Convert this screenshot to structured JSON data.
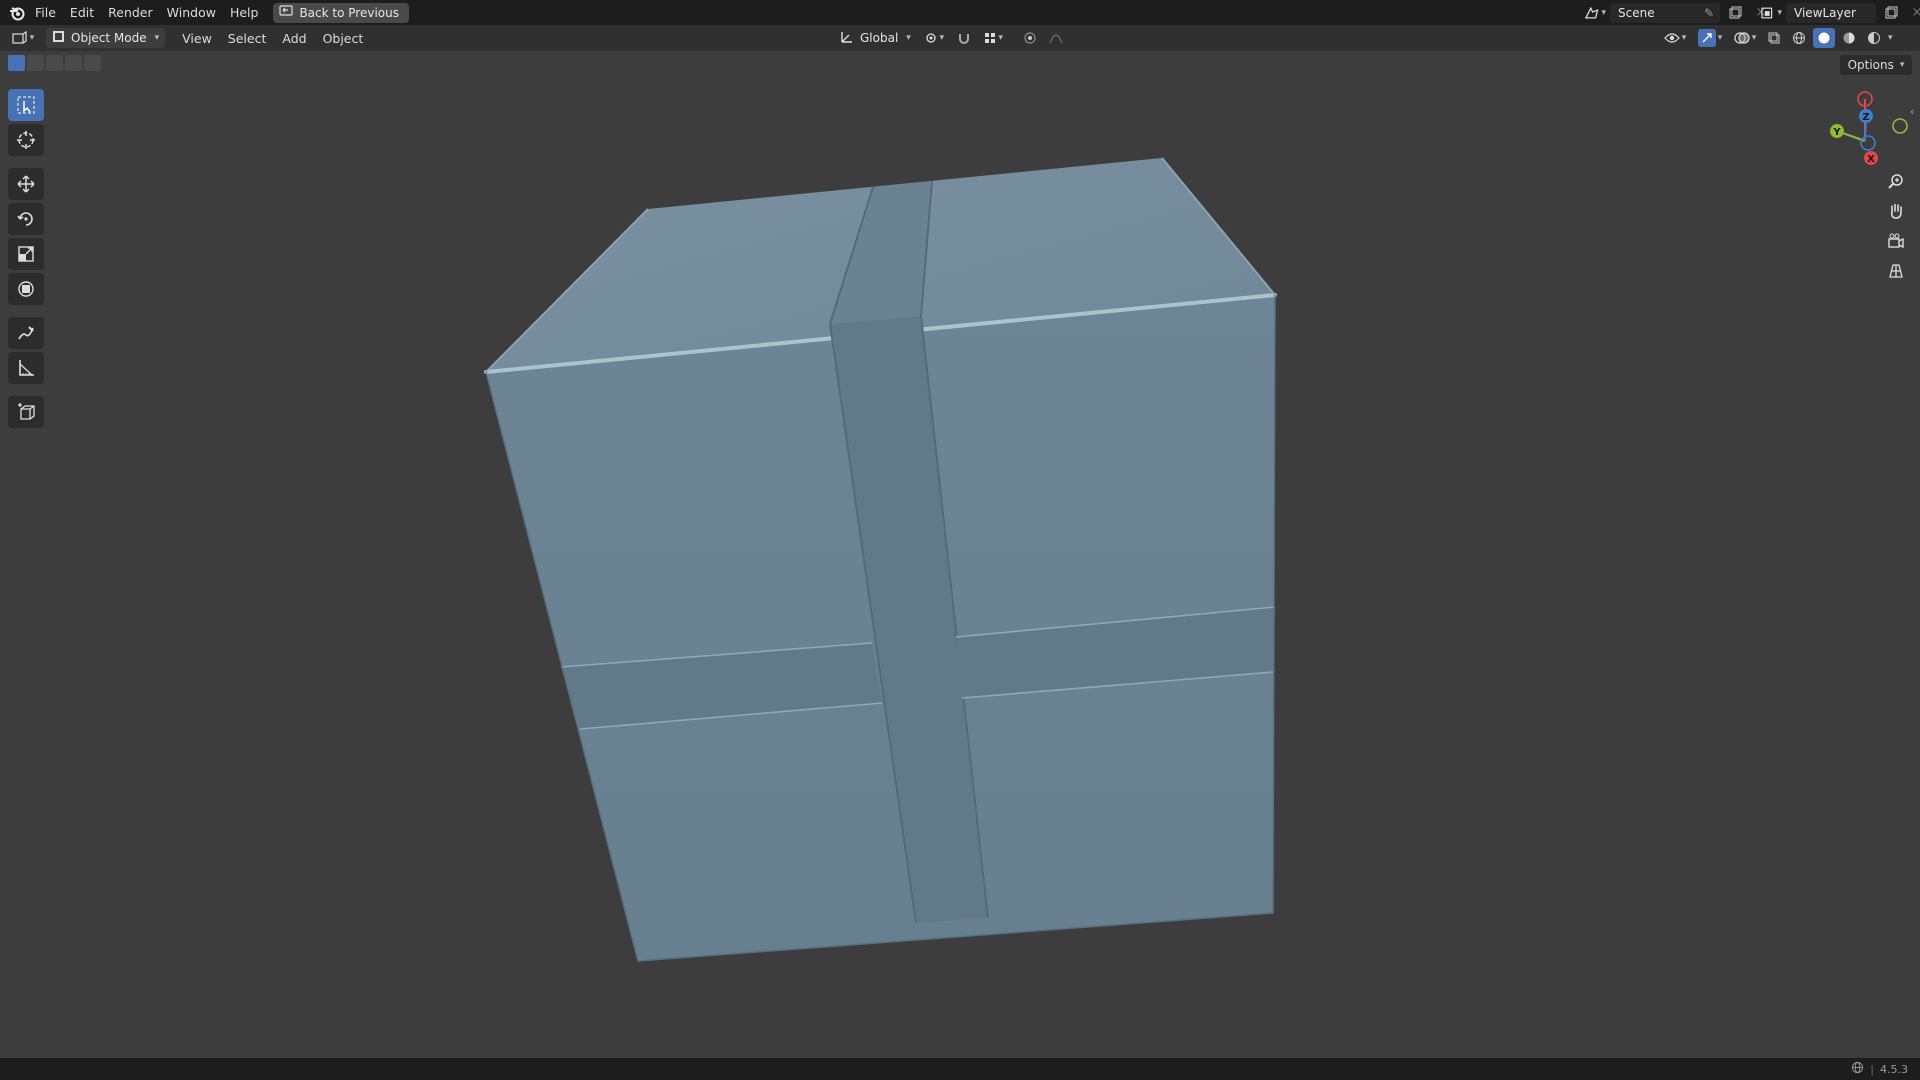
{
  "menu": {
    "items": [
      "File",
      "Edit",
      "Render",
      "Window",
      "Help"
    ],
    "back_button": "Back to Previous"
  },
  "scene": {
    "label": "Scene"
  },
  "view_layer": {
    "label": "ViewLayer"
  },
  "header": {
    "mode": "Object Mode",
    "menus": [
      "View",
      "Select",
      "Add",
      "Object"
    ],
    "orientation": "Global"
  },
  "viewport": {
    "options_label": "Options",
    "gizmo": {
      "x_label": "X",
      "y_label": "Y",
      "z_label": "Z"
    },
    "object_color": "#6b8798"
  },
  "status": {
    "version": "4.5.3"
  },
  "colors": {
    "accent": "#4772b3",
    "axis_x": "#e3464d",
    "axis_y": "#8cbc34",
    "axis_z": "#3f7ecf"
  }
}
